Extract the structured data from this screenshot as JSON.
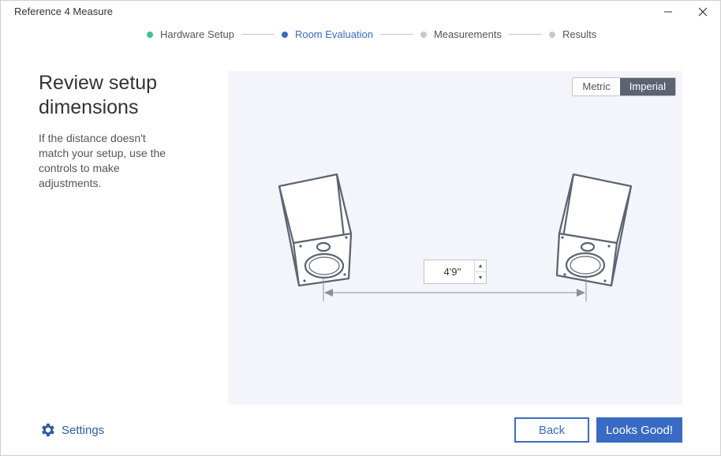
{
  "window": {
    "title": "Reference 4 Measure"
  },
  "stepper": {
    "steps": [
      {
        "label": "Hardware Setup",
        "state": "done",
        "color": "#3ec28f"
      },
      {
        "label": "Room Evaluation",
        "state": "current",
        "color": "#3a6bc4"
      },
      {
        "label": "Measurements",
        "state": "pending",
        "color": "#c7c9cf"
      },
      {
        "label": "Results",
        "state": "pending",
        "color": "#c7c9cf"
      }
    ]
  },
  "main": {
    "heading": "Review setup dimensions",
    "description": "If the distance doesn't match your setup, use the controls to make adjustments."
  },
  "units": {
    "metric_label": "Metric",
    "imperial_label": "Imperial",
    "selected": "Imperial"
  },
  "distance": {
    "value": "4'9''"
  },
  "footer": {
    "settings_label": "Settings",
    "back_label": "Back",
    "confirm_label": "Looks Good!"
  },
  "colors": {
    "accent": "#3a6bc4",
    "done": "#3ec28f",
    "panel_bg": "#f3f5fa"
  },
  "icons": {
    "minimize": "minimize-icon",
    "close": "close-icon",
    "settings": "gear-icon"
  }
}
